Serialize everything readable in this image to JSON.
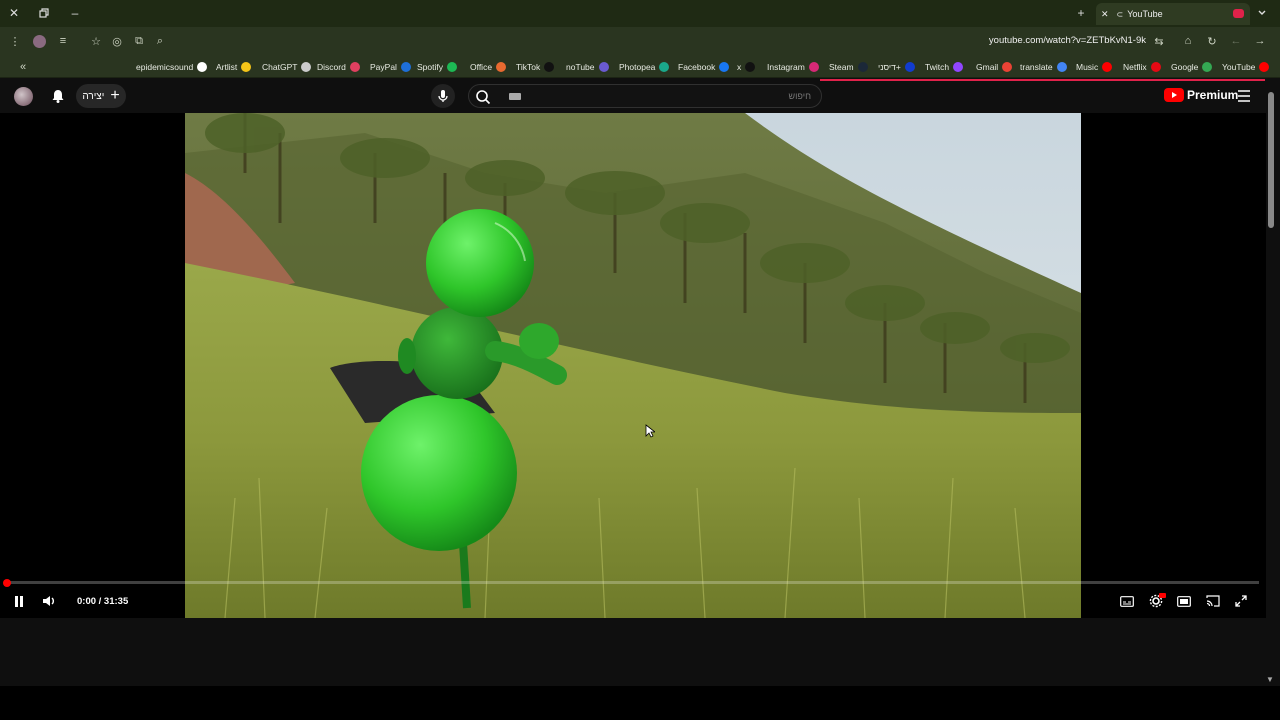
{
  "browser": {
    "tab_title": "YouTube",
    "url": "youtube.com/watch?v=ZETbKvN1-9k",
    "bookmarks": [
      {
        "label": "epidemicsound",
        "color": "#ffffff"
      },
      {
        "label": "Artlist",
        "color": "#f5c518"
      },
      {
        "label": "ChatGPT",
        "color": "#cccccc"
      },
      {
        "label": "Discord",
        "color": "#e04060"
      },
      {
        "label": "PayPal",
        "color": "#1e6fd8"
      },
      {
        "label": "Spotify",
        "color": "#1db954"
      },
      {
        "label": "Office",
        "color": "#e86a30"
      },
      {
        "label": "TikTok",
        "color": "#111111"
      },
      {
        "label": "noTube",
        "color": "#6a5ad0"
      },
      {
        "label": "Photopea",
        "color": "#1aa88a"
      },
      {
        "label": "Facebook",
        "color": "#1877f2"
      },
      {
        "label": "x",
        "color": "#111111"
      },
      {
        "label": "Instagram",
        "color": "#d62976"
      },
      {
        "label": "Steam",
        "color": "#1b2838"
      },
      {
        "label": "דיסני+",
        "color": "#113ccf"
      },
      {
        "label": "Twitch",
        "color": "#9146ff"
      },
      {
        "label": "Gmail",
        "color": "#ea4335"
      },
      {
        "label": "translate",
        "color": "#4285f4"
      },
      {
        "label": "Music",
        "color": "#ff0000"
      },
      {
        "label": "Netflix",
        "color": "#e50914"
      },
      {
        "label": "Google",
        "color": "#34a853"
      },
      {
        "label": "YouTube",
        "color": "#ff0000"
      }
    ]
  },
  "youtube": {
    "create_label": "יצירה",
    "search_placeholder": "חיפוש",
    "premium_label": "Premium"
  },
  "player": {
    "time": "0:00 / 31:35",
    "progress": 0.0
  }
}
